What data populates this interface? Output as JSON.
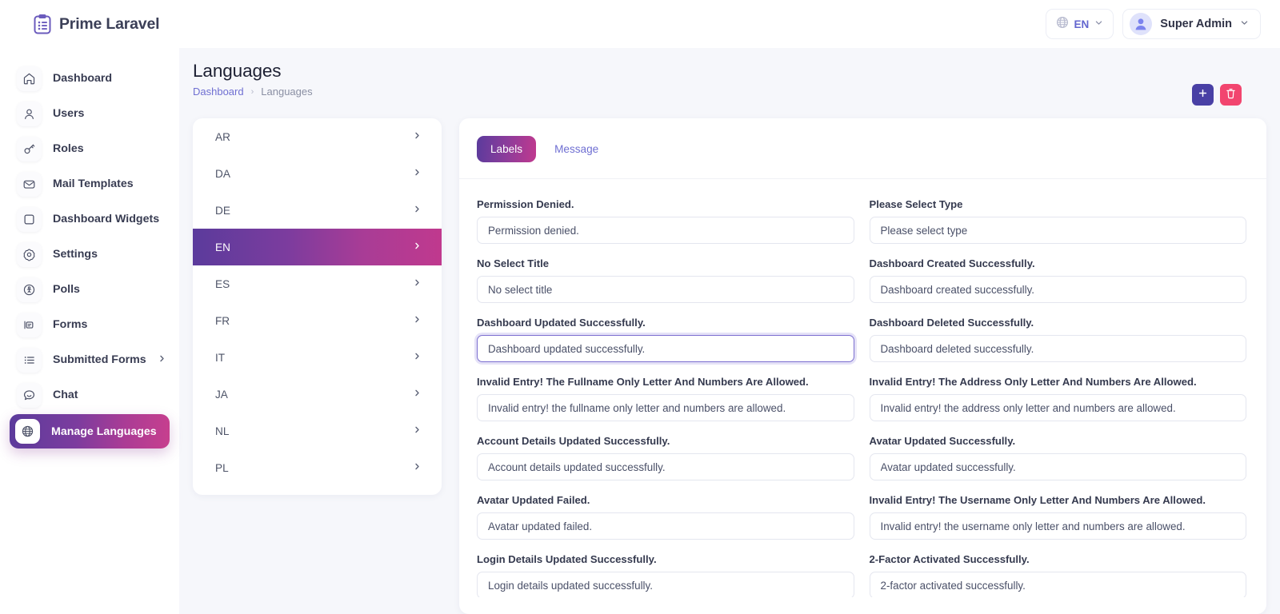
{
  "brand": {
    "name": "Prime Laravel",
    "logo_icon": "clipboard-list-icon"
  },
  "topbar": {
    "language_selector": {
      "icon": "globe-icon",
      "value": "EN",
      "chevron_icon": "chevron-down-icon"
    },
    "user_menu": {
      "avatar_icon": "user-avatar-icon",
      "name": "Super Admin",
      "chevron_icon": "chevron-down-icon"
    }
  },
  "sidebar": {
    "items": [
      {
        "label": "Dashboard",
        "icon": "home-icon",
        "active": false,
        "has_submenu": false
      },
      {
        "label": "Users",
        "icon": "user-icon",
        "active": false,
        "has_submenu": false
      },
      {
        "label": "Roles",
        "icon": "key-icon",
        "active": false,
        "has_submenu": false
      },
      {
        "label": "Mail Templates",
        "icon": "envelope-icon",
        "active": false,
        "has_submenu": false
      },
      {
        "label": "Dashboard Widgets",
        "icon": "square-icon",
        "active": false,
        "has_submenu": false
      },
      {
        "label": "Settings",
        "icon": "gear-icon",
        "active": false,
        "has_submenu": false
      },
      {
        "label": "Polls",
        "icon": "poll-circle-icon",
        "active": false,
        "has_submenu": false
      },
      {
        "label": "Forms",
        "icon": "form-icon",
        "active": false,
        "has_submenu": false
      },
      {
        "label": "Submitted Forms",
        "icon": "list-icon",
        "active": false,
        "has_submenu": true
      },
      {
        "label": "Chat",
        "icon": "chat-bubble-icon",
        "active": false,
        "has_submenu": false
      },
      {
        "label": "Manage Languages",
        "icon": "globe-icon",
        "active": true,
        "has_submenu": false
      }
    ]
  },
  "page": {
    "title": "Languages",
    "breadcrumb": {
      "parent": "Dashboard",
      "separator": "›",
      "current": "Languages"
    },
    "actions": [
      {
        "name": "add-language-button",
        "icon": "plus-icon",
        "label": "+",
        "color": "#4940a5"
      },
      {
        "name": "delete-language-button",
        "icon": "trash-icon",
        "label": "",
        "color": "#f2456f"
      }
    ]
  },
  "language_list": {
    "chevron_icon": "chevron-right-icon",
    "items": [
      {
        "code": "AR",
        "selected": false
      },
      {
        "code": "DA",
        "selected": false
      },
      {
        "code": "DE",
        "selected": false
      },
      {
        "code": "EN",
        "selected": true
      },
      {
        "code": "ES",
        "selected": false
      },
      {
        "code": "FR",
        "selected": false
      },
      {
        "code": "IT",
        "selected": false
      },
      {
        "code": "JA",
        "selected": false
      },
      {
        "code": "NL",
        "selected": false
      },
      {
        "code": "PL",
        "selected": false
      }
    ]
  },
  "labels_panel": {
    "tabs": [
      {
        "label": "Labels",
        "active": true
      },
      {
        "label": "Message",
        "active": false
      }
    ],
    "fields": [
      {
        "label": "Permission Denied.",
        "value": "Permission denied.",
        "focused": false
      },
      {
        "label": "Please Select Type",
        "value": "Please select type",
        "focused": false
      },
      {
        "label": "No Select Title",
        "value": "No select title",
        "focused": false
      },
      {
        "label": "Dashboard Created Successfully.",
        "value": "Dashboard created successfully.",
        "focused": false
      },
      {
        "label": "Dashboard Updated Successfully.",
        "value": "Dashboard updated successfully.",
        "focused": true
      },
      {
        "label": "Dashboard Deleted Successfully.",
        "value": "Dashboard deleted successfully.",
        "focused": false
      },
      {
        "label": "Invalid Entry! The Fullname Only Letter And Numbers Are Allowed.",
        "value": "Invalid entry! the fullname only letter and numbers are allowed.",
        "focused": false
      },
      {
        "label": "Invalid Entry! The Address Only Letter And Numbers Are Allowed.",
        "value": "Invalid entry! the address only letter and numbers are allowed.",
        "focused": false
      },
      {
        "label": "Account Details Updated Successfully.",
        "value": "Account details updated successfully.",
        "focused": false
      },
      {
        "label": "Avatar Updated Successfully.",
        "value": "Avatar updated successfully.",
        "focused": false
      },
      {
        "label": "Avatar Updated Failed.",
        "value": "Avatar updated failed.",
        "focused": false
      },
      {
        "label": "Invalid Entry! The Username Only Letter And Numbers Are Allowed.",
        "value": "Invalid entry! the username only letter and numbers are allowed.",
        "focused": false
      },
      {
        "label": "Login Details Updated Successfully.",
        "value": "Login details updated successfully.",
        "focused": false
      },
      {
        "label": "2-Factor Activated Successfully.",
        "value": "2-factor activated successfully.",
        "focused": false
      }
    ]
  },
  "theme": {
    "gradient_start": "#5b3b9c",
    "gradient_end": "#c0398e",
    "accent": "#6f6fd2",
    "add_button": "#4940a5",
    "delete_button": "#f2456f",
    "page_background": "#f6f7fb"
  }
}
